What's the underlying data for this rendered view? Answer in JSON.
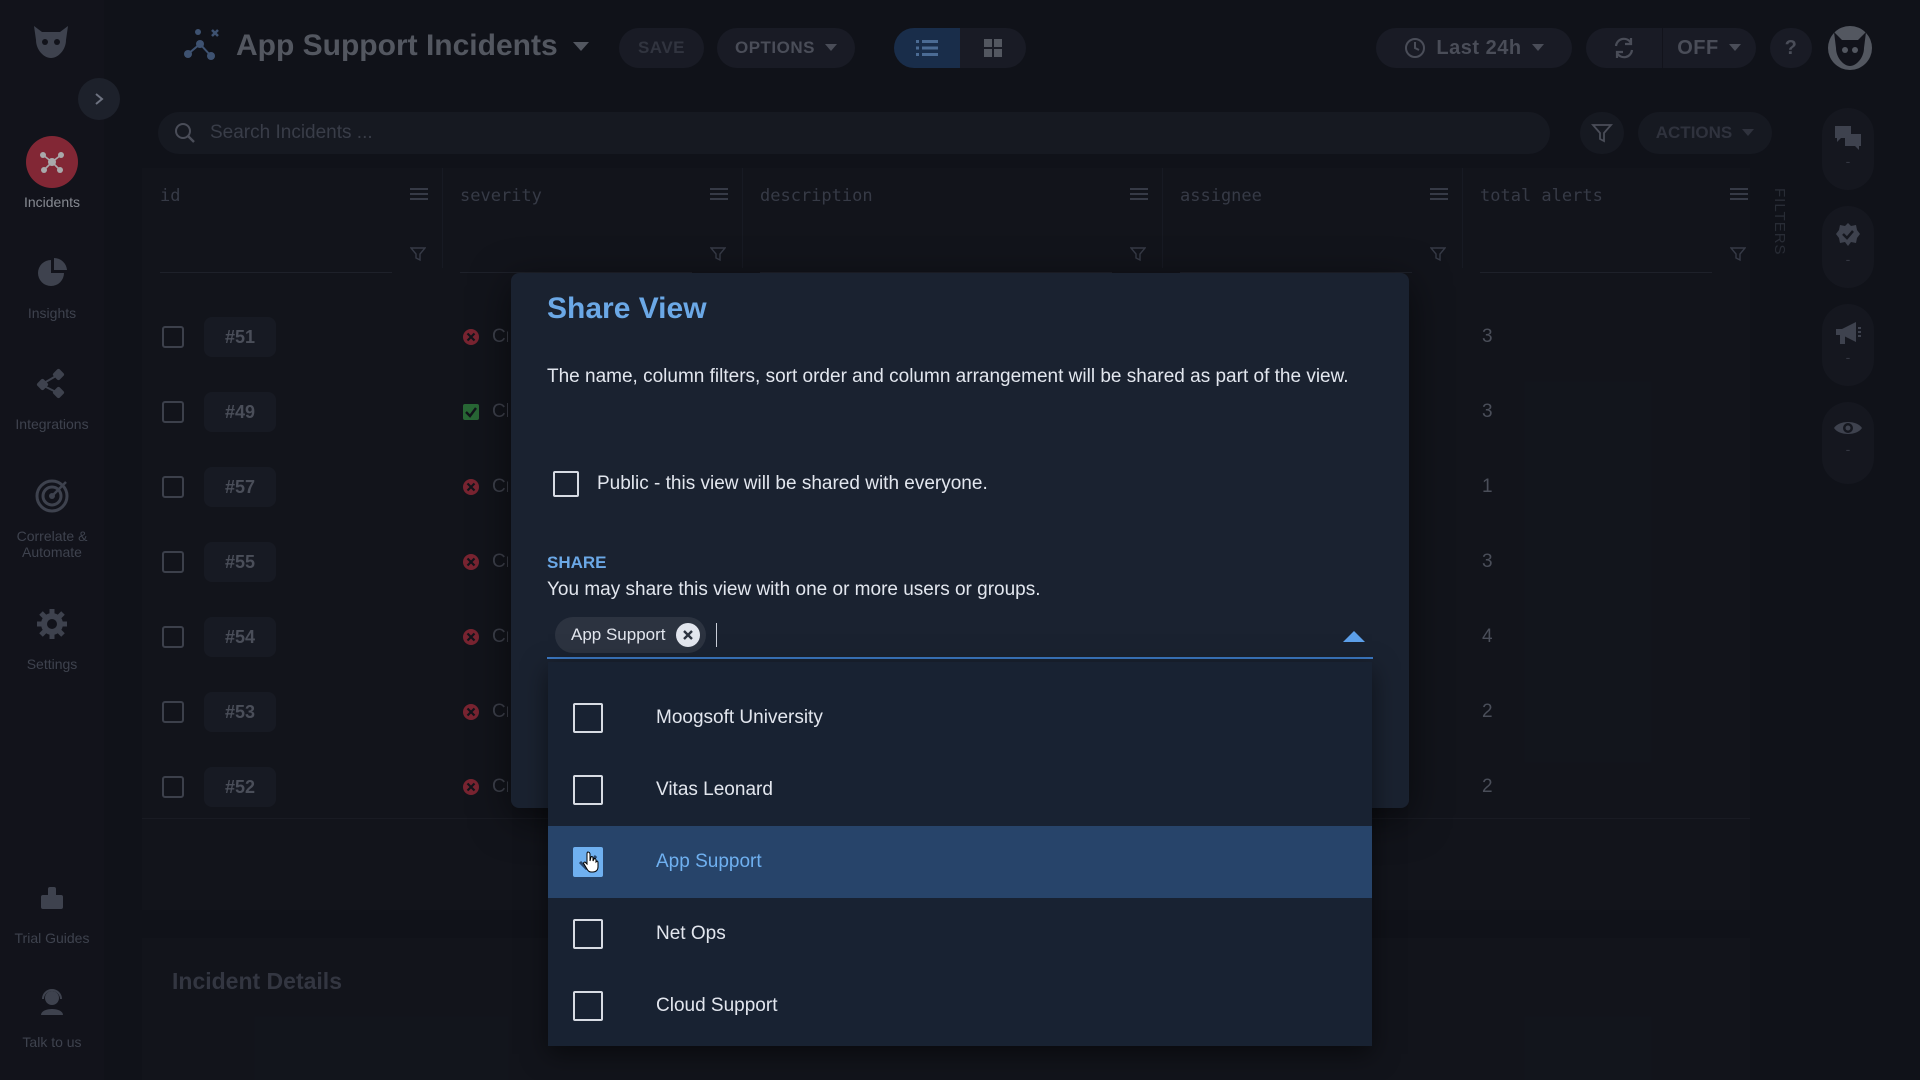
{
  "colors": {
    "accent": "#6ba8e6",
    "incident_red": "#c4384a",
    "selected_row": "#27446a",
    "dialog_bg": "#1a2230"
  },
  "nav": {
    "items": [
      {
        "label": "Incidents",
        "icon": "incidents-icon",
        "active": true
      },
      {
        "label": "Insights",
        "icon": "pie-chart-icon"
      },
      {
        "label": "Integrations",
        "icon": "integrations-icon"
      },
      {
        "label": "Correlate &\nAutomate",
        "icon": "target-icon"
      },
      {
        "label": "Settings",
        "icon": "gear-icon"
      },
      {
        "label": "Trial Guides",
        "icon": "guides-icon"
      },
      {
        "label": "Talk to us",
        "icon": "support-agent-icon"
      }
    ]
  },
  "topbar": {
    "title": "App Support Incidents",
    "save_label": "SAVE",
    "options_label": "OPTIONS",
    "timerange_label": "Last 24h",
    "refresh_label": "OFF",
    "help_label": "?"
  },
  "search": {
    "placeholder": "Search Incidents ...",
    "actions_label": "ACTIONS"
  },
  "grid": {
    "columns": [
      "id",
      "severity",
      "description",
      "assignee",
      "total alerts"
    ],
    "rows": [
      {
        "id": "#51",
        "severity": "Cr",
        "sev_type": "critical",
        "alerts": "3"
      },
      {
        "id": "#49",
        "severity": "Cl",
        "sev_type": "clear",
        "alerts": "3"
      },
      {
        "id": "#57",
        "severity": "Cr",
        "sev_type": "critical",
        "alerts": "1"
      },
      {
        "id": "#55",
        "severity": "Cr",
        "sev_type": "critical",
        "alerts": "3"
      },
      {
        "id": "#54",
        "severity": "Cr",
        "sev_type": "critical",
        "alerts": "4"
      },
      {
        "id": "#53",
        "severity": "Cr",
        "sev_type": "critical",
        "alerts": "2"
      },
      {
        "id": "#52",
        "severity": "Cr",
        "sev_type": "critical",
        "alerts": "2"
      }
    ],
    "filters_label": "FILTERS"
  },
  "details": {
    "title": "Incident Details"
  },
  "dialog": {
    "title": "Share View",
    "description": "The name, column filters, sort order and column arrangement will be shared as part of the view.",
    "public_label": "Public - this view will be shared with everyone.",
    "public_checked": false,
    "share_heading": "SHARE",
    "share_sub": "You may share this view with one or more users or groups.",
    "chips": [
      "App Support"
    ],
    "options": [
      {
        "label": "Moogsoft University",
        "checked": false
      },
      {
        "label": "Vitas Leonard",
        "checked": false
      },
      {
        "label": "App Support",
        "checked": true
      },
      {
        "label": "Net Ops",
        "checked": false
      },
      {
        "label": "Cloud Support",
        "checked": false
      }
    ]
  }
}
